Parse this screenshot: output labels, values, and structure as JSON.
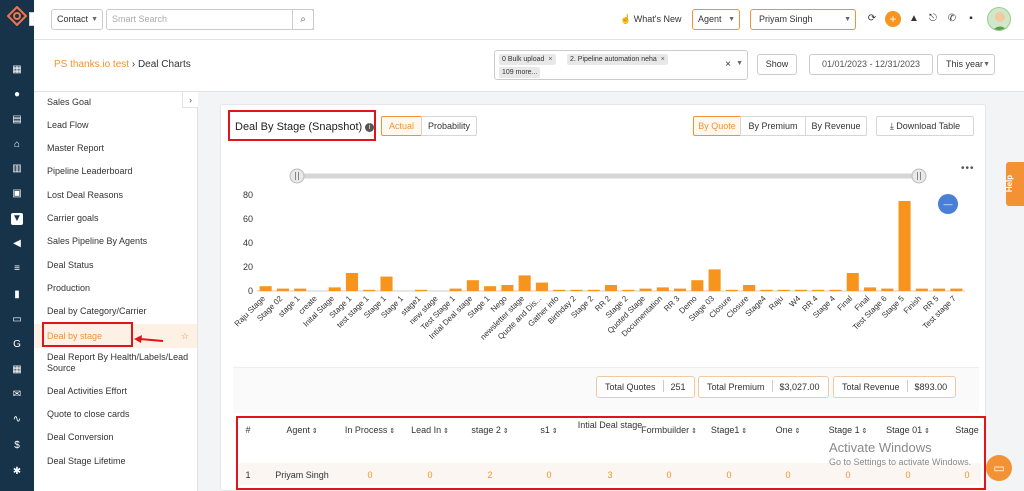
{
  "topbar": {
    "contact_label": "Contact",
    "search_placeholder": "Smart Search",
    "whats_new": "What's New",
    "agent_label": "Agent",
    "user_name": "Priyam Singh"
  },
  "subheader": {
    "breadcrumb_link": "PS thanks.io test",
    "breadcrumb_current": "Deal Charts",
    "tags": [
      "0 Bulk upload",
      "2. Pipeline automation neha",
      "109 more..."
    ],
    "show_label": "Show",
    "date_range": "01/01/2023 - 12/31/2023",
    "period": "This year"
  },
  "nav": {
    "items": [
      "Sales Goal",
      "Lead Flow",
      "Master Report",
      "Pipeline Leaderboard",
      "Lost Deal Reasons",
      "Carrier goals",
      "Sales Pipeline By Agents",
      "Deal Status",
      "Production",
      "Deal by Category/Carrier",
      "Deal by stage",
      "Deal Report By Health/Labels/Lead Source",
      "Deal Activities Effort",
      "Quote to close cards",
      "Deal Conversion",
      "Deal Stage Lifetime"
    ]
  },
  "card": {
    "title": "Deal By Stage (Snapshot)",
    "toggle_actual": "Actual",
    "toggle_probability": "Probability",
    "by_quote": "By Quote",
    "by_premium": "By Premium",
    "by_revenue": "By Revenue",
    "download": "Download Table"
  },
  "chart_data": {
    "type": "bar",
    "color": "#f7941d",
    "ylim": [
      0,
      85
    ],
    "yticks": [
      0,
      20,
      40,
      60,
      80
    ],
    "categories": [
      "Raju Stage",
      "Stage 02",
      "stage 1",
      "create",
      "Inital Stage",
      "Stage 1",
      "test stage 1",
      "Stage 1",
      "Stage 1",
      "stage1",
      "new stage",
      "Test Stage 1",
      "Intial Deal stage",
      "Stage 1",
      "Nego",
      "newsletter stage",
      "Quote and Dis...",
      "Gather info",
      "Birthday 2",
      "Stage 2",
      "RR 2",
      "Stage 2",
      "Quoted Stage",
      "Documentation",
      "RR 3",
      "Demo",
      "Stage 03",
      "Closure",
      "Closure",
      "Stage4",
      "Raju",
      "W4",
      "RR 4",
      "Stage 4",
      "Final",
      "Final",
      "Test Stage 6",
      "Stage 5",
      "Finish",
      "RR 5",
      "Test stage 7"
    ],
    "values": [
      4,
      2,
      2,
      0,
      3,
      15,
      1,
      12,
      0,
      1,
      0,
      2,
      9,
      4,
      5,
      13,
      7,
      1,
      1,
      1,
      5,
      1,
      2,
      3,
      2,
      9,
      18,
      1,
      5,
      1,
      1,
      1,
      1,
      1,
      15,
      3,
      2,
      75,
      2,
      2,
      2
    ]
  },
  "stats": {
    "quotes_label": "Total Quotes",
    "quotes_value": "251",
    "premium_label": "Total Premium",
    "premium_value": "$3,027.00",
    "revenue_label": "Total Revenue",
    "revenue_value": "$893.00"
  },
  "table": {
    "headers": [
      "#",
      "Agent",
      "In Process",
      "Lead In",
      "stage 2",
      "s1",
      "Intial Deal stage",
      "Formbuilder",
      "Stage1",
      "One",
      "Stage 1",
      "Stage 01",
      "Stage"
    ],
    "rows": [
      [
        "1",
        "Priyam Singh",
        "0",
        "0",
        "2",
        "0",
        "3",
        "0",
        "0",
        "0",
        "0",
        "0",
        "0"
      ]
    ]
  },
  "watermark": {
    "line1": "Activate Windows",
    "line2": "Go to Settings to activate Windows."
  },
  "help_label": "Help"
}
